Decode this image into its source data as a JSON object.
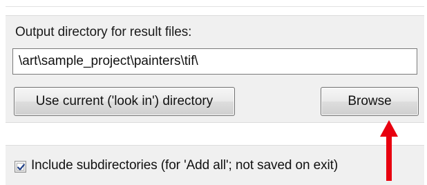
{
  "output_group": {
    "label": "Output directory for result files:",
    "path_value": "\\art\\sample_project\\painters\\tif\\"
  },
  "buttons": {
    "use_current_label": "Use current ('look in') directory",
    "browse_label": "Browse"
  },
  "include_subdirs": {
    "label": "Include subdirectories (for 'Add all'; not saved on exit)",
    "checked": true
  },
  "annotation": {
    "arrow_color": "#e8000f",
    "icon": "red-arrow-up-icon"
  },
  "colors": {
    "panel": "#f0f0f0",
    "checkmark": "#1f3f86"
  }
}
